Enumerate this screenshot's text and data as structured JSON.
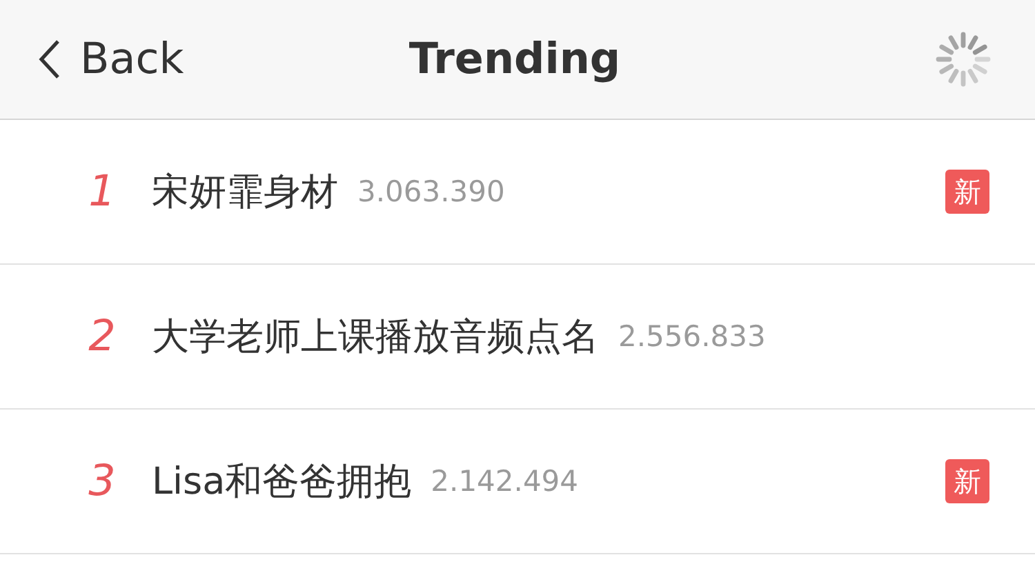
{
  "nav": {
    "back": "Back",
    "title": "Trending",
    "loading": true
  },
  "items": [
    {
      "rank": "1",
      "title": "宋妍霏身材",
      "count": "3.063.390",
      "badge": "新"
    },
    {
      "rank": "2",
      "title": "大学老师上课播放音频点名",
      "count": "2.556.833"
    },
    {
      "rank": "3",
      "title": "Lisa和爸爸拥抱",
      "count": "2.142.494",
      "badge": "新"
    }
  ]
}
